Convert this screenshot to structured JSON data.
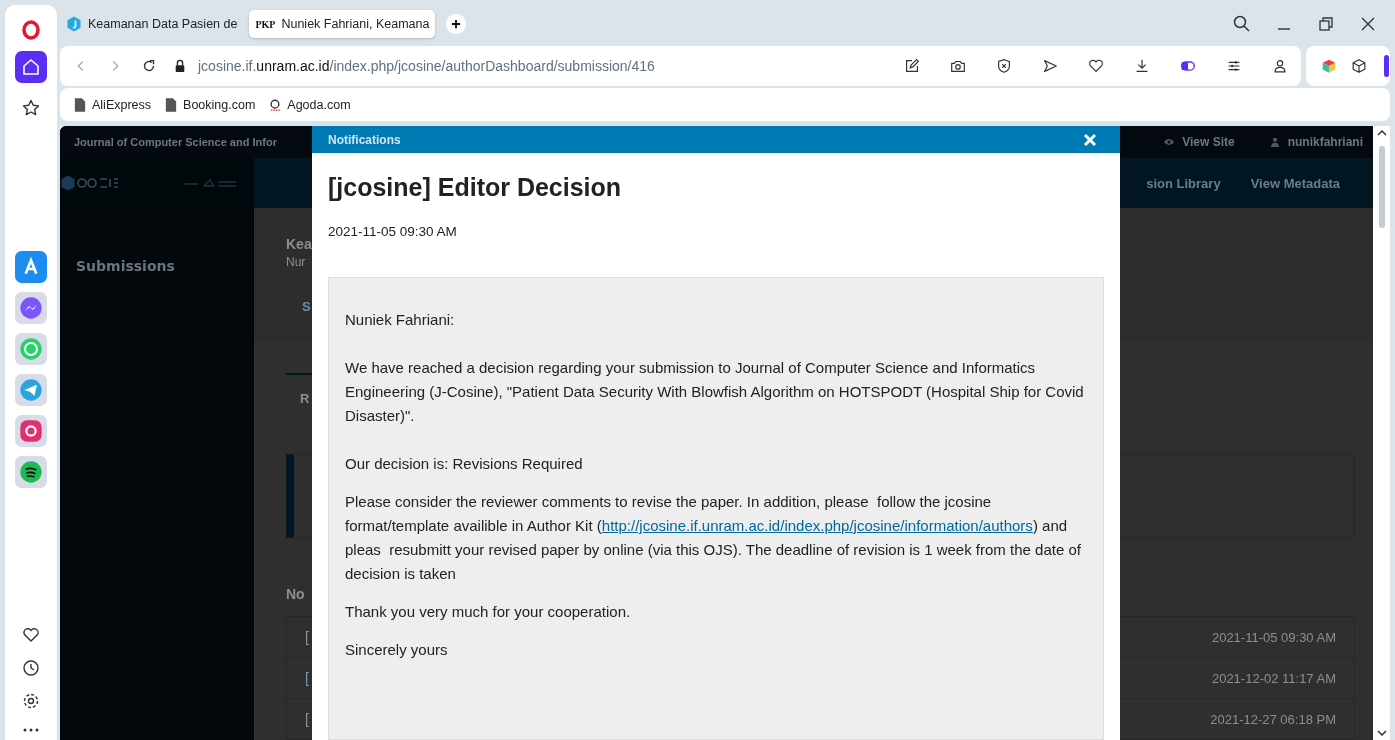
{
  "browser": {
    "tabs": [
      {
        "title": "Keamanan Data Pasien de",
        "selected": false,
        "kind": "hexagon"
      },
      {
        "title": "Nuniek Fahriani, Keamana",
        "selected": true,
        "kind": "text",
        "favicon_text": "PKP"
      }
    ],
    "address": {
      "prefix": "jcosine.if.",
      "domain": "unram.ac.id",
      "path": "/index.php/jcosine/authorDashboard/submission/416"
    },
    "bookmarks": [
      {
        "label": "AliExpress",
        "kind": "page"
      },
      {
        "label": "Booking.com",
        "kind": "page"
      },
      {
        "label": "Agoda.com",
        "kind": "agoda"
      }
    ],
    "sidebar": [
      {
        "kind": "home",
        "selected": true
      },
      {
        "kind": "star",
        "selected": false
      }
    ]
  },
  "page": {
    "top_bar": {
      "journal": "Journal of Computer Science and Infor",
      "view_site": "View Site",
      "user": "nunikfahriani"
    },
    "nav": [
      "sion Library",
      "View Metadata"
    ],
    "sidebar": [
      "Submissions"
    ],
    "submission_title": "Kea",
    "submission_authors": "Nur",
    "stage_tab": "S",
    "panel_tab": "R",
    "notifications_heading": "No",
    "notification_rows": [
      {
        "title": "[",
        "date": "2021-11-05 09:30 AM"
      },
      {
        "title": "[",
        "date": "2021-12-02 11:17 AM"
      },
      {
        "title": "[",
        "date": "2021-12-27 06:18 PM"
      }
    ]
  },
  "modal": {
    "header": "Notifications",
    "title": "[jcosine] Editor Decision",
    "date": "2021-11-05 09:30 AM",
    "paragraphs": [
      {
        "parts": [
          {
            "text": "Nuniek Fahriani:",
            "link": false
          }
        ]
      },
      {
        "parts": [
          {
            "text": "We have reached a decision regarding your submission to Journal of Computer Science and Informatics Engineering (J-Cosine), \"Patient Data Security With Blowfish Algorithm on HOTSPODT (Hospital Ship for Covid Disaster)\".",
            "link": false
          }
        ]
      },
      {
        "parts": [
          {
            "text": "Our decision is: Revisions Required",
            "link": false
          }
        ]
      },
      {
        "parts": [
          {
            "text": "Please consider the reviewer comments to revise the paper. In addition, please  follow the jcosine format/template availible in Author Kit (",
            "link": false
          },
          {
            "text": "http://jcosine.if.unram.ac.id/index.php/jcosine/information/authors",
            "link": true
          },
          {
            "text": ") and pleas  resubmitt your revised paper by online (via this OJS). The deadline of revision is 1 week from the date of decision is taken",
            "link": false
          }
        ]
      },
      {
        "parts": [
          {
            "text": "Thank you very much for your cooperation.",
            "link": false
          }
        ]
      },
      {
        "parts": [
          {
            "text": "Sincerely yours",
            "link": false
          }
        ]
      }
    ]
  }
}
